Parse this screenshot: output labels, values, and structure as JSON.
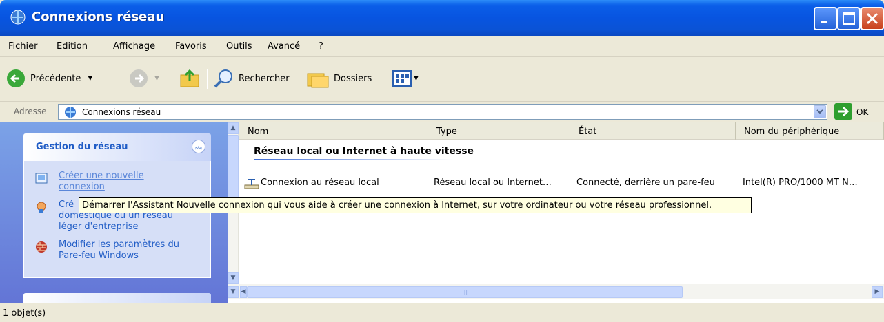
{
  "window": {
    "title": "Connexions réseau"
  },
  "menu": [
    "Fichier",
    "Edition",
    "Affichage",
    "Favoris",
    "Outils",
    "Avancé",
    "?"
  ],
  "toolbar": {
    "back_label": "Précédente",
    "search_label": "Rechercher",
    "folders_label": "Dossiers"
  },
  "address": {
    "label": "Adresse",
    "value": "Connexions réseau",
    "go_label": "OK"
  },
  "taskpane": {
    "title": "Gestion du réseau",
    "tasks": [
      {
        "line1": "Créer une nouvelle",
        "line2": "connexion"
      },
      {
        "line1": "Cré",
        "line2": "domestique ou un réseau",
        "line3": "léger d'entreprise"
      },
      {
        "line1": "Modifier les paramètres du",
        "line2": "Pare-feu Windows"
      }
    ]
  },
  "list": {
    "columns": [
      "Nom",
      "Type",
      "État",
      "Nom du périphérique"
    ],
    "group": "Réseau local ou Internet à haute vitesse",
    "rows": [
      {
        "name": "Connexion au réseau local",
        "type": "Réseau local ou Internet…",
        "state": "Connecté, derrière un pare-feu",
        "device": "Intel(R) PRO/1000 MT N…"
      }
    ]
  },
  "tooltip": "Démarrer l'Assistant Nouvelle connexion qui vous aide à créer une connexion à Internet, sur votre ordinateur ou votre réseau professionnel.",
  "status": "1 objet(s)",
  "colors": {
    "titlebar": "#0a5ee8",
    "link": "#215dc6",
    "tooltip_bg": "#ffffe1"
  }
}
